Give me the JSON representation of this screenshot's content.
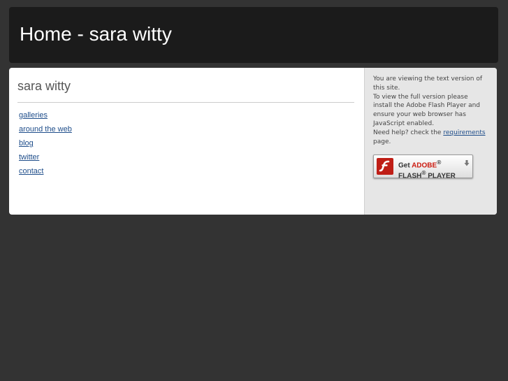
{
  "header": {
    "title": "Home - sara witty"
  },
  "main": {
    "site_title": "sara witty",
    "nav": [
      {
        "label": "galleries"
      },
      {
        "label": "around the web"
      },
      {
        "label": "blog"
      },
      {
        "label": "twitter"
      },
      {
        "label": "contact"
      }
    ]
  },
  "sidebar": {
    "notice_line1": "You are viewing the text version of this site.",
    "notice_line2": "To view the full version please install the Adobe Flash Player and ensure your web browser has JavaScript enabled.",
    "help_prefix": "Need help? check the ",
    "help_link": "requirements",
    "help_suffix": " page.",
    "flash_badge": {
      "get": "Get ",
      "adobe": "ADOBE",
      "reg": "®",
      "flash": "FLASH",
      "player": " PLAYER",
      "logo_icon": "flash-player-icon",
      "download_icon": "download-arrow-icon"
    }
  },
  "colors": {
    "page_background": "#333333",
    "header_background": "#1b1b1b",
    "link": "#1e4d8a",
    "adobe_red": "#cc1b10"
  }
}
